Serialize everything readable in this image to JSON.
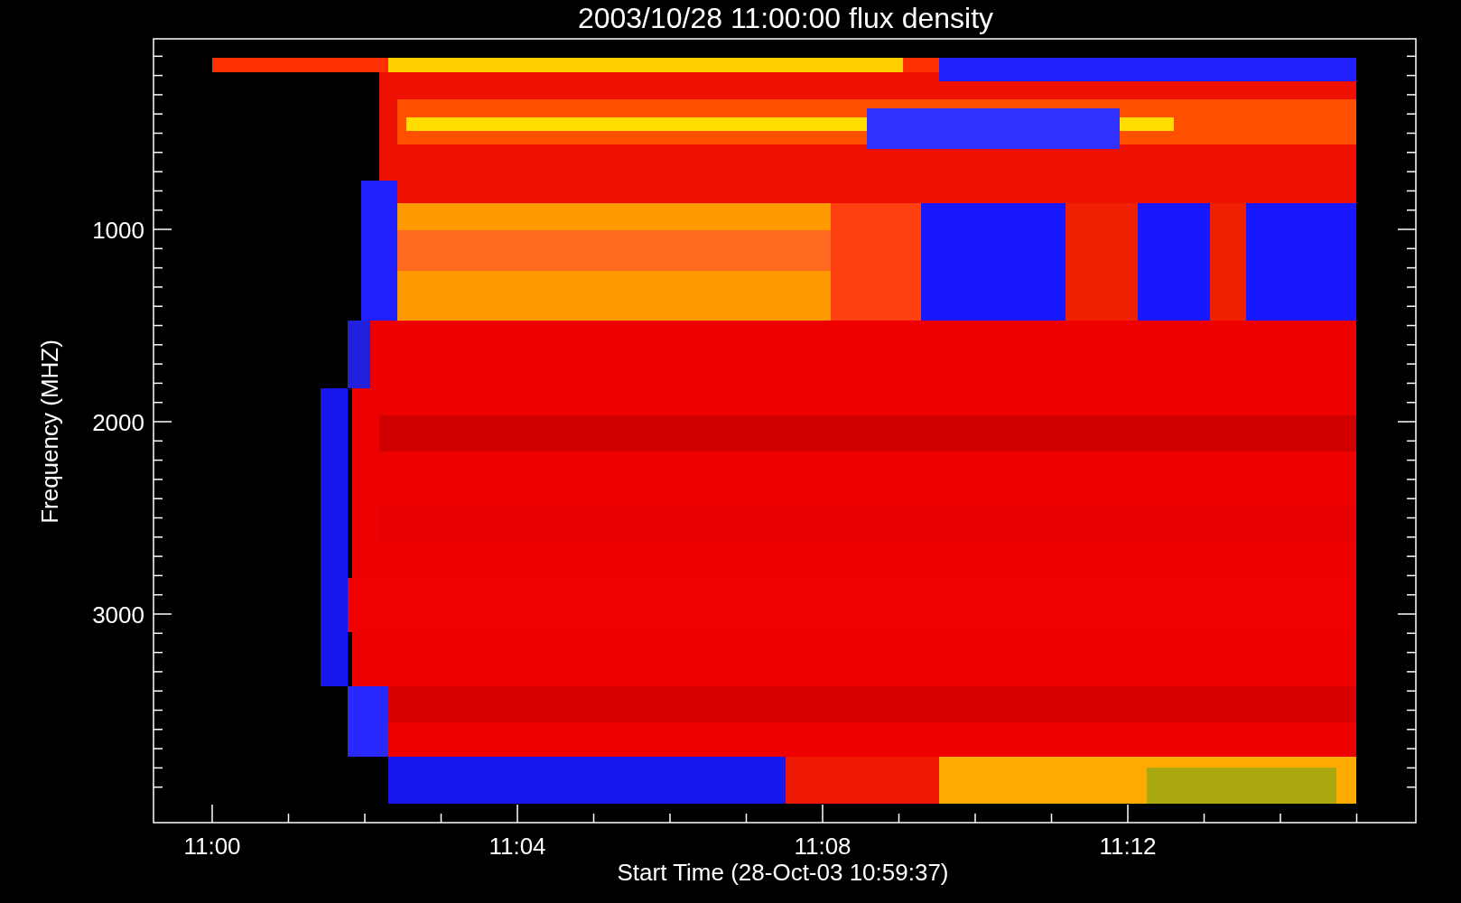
{
  "title": "2003/10/28 11:00:00 flux density",
  "plot": {
    "xlabel": "Start Time (28-Oct-03 10:59:37)",
    "ylabel": "Frequency (MHZ)",
    "xticks": [
      "11:00",
      "11:04",
      "11:08",
      "11:12"
    ],
    "yticks": [
      "1000",
      "2000",
      "3000"
    ]
  }
}
